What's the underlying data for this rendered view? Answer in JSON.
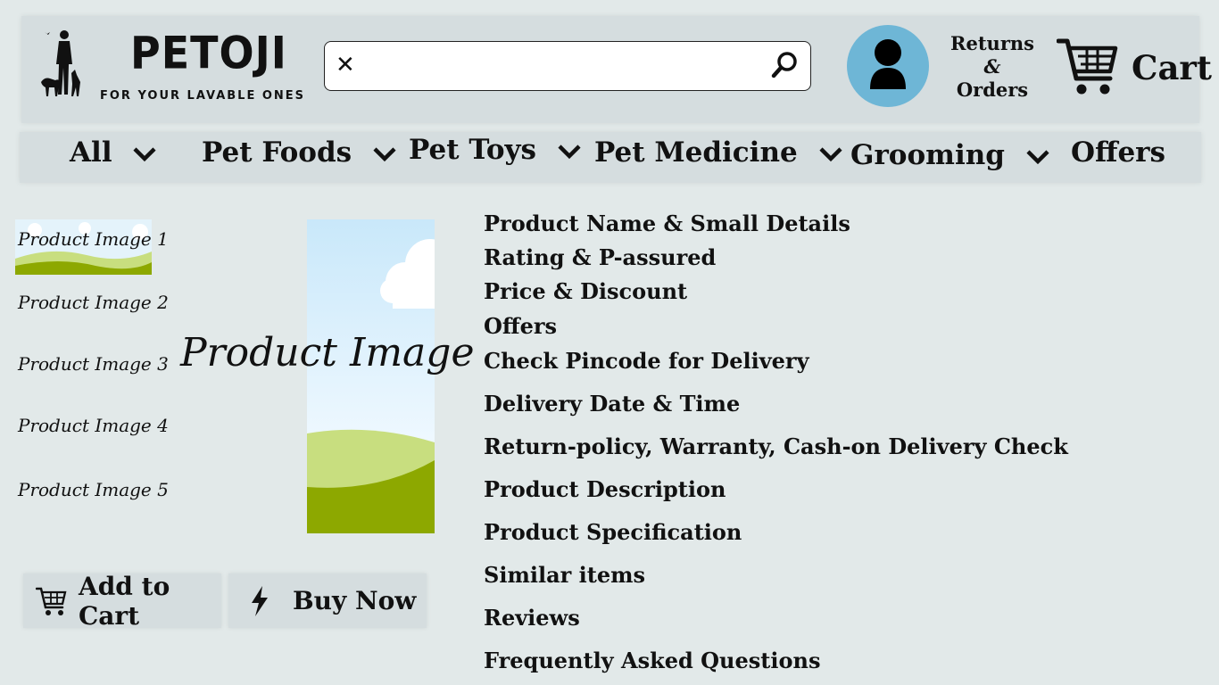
{
  "header": {
    "brand": "PETOJI",
    "tagline": "FOR YOUR LAVABLE ONES",
    "search": {
      "value": "",
      "placeholder": ""
    },
    "returns": {
      "line1": "Returns",
      "line2": "&",
      "line3": "Orders"
    },
    "cart_label": "Cart"
  },
  "nav": {
    "items": [
      {
        "label": "All"
      },
      {
        "label": "Pet Foods"
      },
      {
        "label": "Pet Toys"
      },
      {
        "label": "Pet Medicine"
      },
      {
        "label": "Grooming"
      },
      {
        "label": "Offers"
      }
    ]
  },
  "gallery": {
    "thumbnails": [
      "Product Image 1",
      "Product Image 2",
      "Product Image 3",
      "Product Image 4",
      "Product Image 5"
    ],
    "main_caption": "Product Image"
  },
  "actions": {
    "add_to_cart": "Add to Cart",
    "buy_now": "Buy Now"
  },
  "details": [
    "Product Name & Small Details",
    "Rating & P-assured",
    "Price & Discount",
    "Offers",
    "Check Pincode for Delivery",
    "Delivery Date & Time",
    "Return-policy, Warranty, Cash-on Delivery Check",
    "Product Description",
    "Product Specification",
    "Similar items",
    "Reviews",
    "Frequently Asked Questions"
  ],
  "colors": {
    "background": "#e2e9e9",
    "bar": "#d5dddf",
    "account_circle": "#6eb6d6",
    "grass_dark": "#8da800",
    "grass_light": "#c8de7f",
    "sky": "#d7eefb"
  }
}
